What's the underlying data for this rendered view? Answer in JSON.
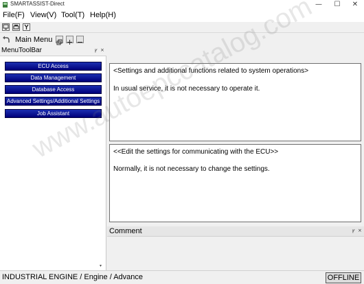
{
  "window": {
    "title": "SMARTASSIST-Direct",
    "controls": {
      "minimize": "—",
      "maximize": "☐",
      "close": "✕"
    }
  },
  "menubar": {
    "items": [
      {
        "label": "File(F)"
      },
      {
        "label": "View(V)"
      },
      {
        "label": "Tool(T)"
      },
      {
        "label": "Help(H)"
      }
    ]
  },
  "toolbar": {
    "icons": [
      "monitor-icon",
      "printer-icon",
      "wrench-icon"
    ]
  },
  "navbar": {
    "title": "Main Menu",
    "back_icon": "back-arrow-icon"
  },
  "left_pane": {
    "title": "MenuToolBar",
    "controls": {
      "restore": "ꝩ",
      "close": "×"
    },
    "buttons": [
      {
        "label": "ECU Access"
      },
      {
        "label": "Data Management"
      },
      {
        "label": "Database Access"
      },
      {
        "label": "Advanced Settings/Additional Settings"
      },
      {
        "label": "Job Assistant"
      }
    ]
  },
  "info_boxes": [
    {
      "heading": "<Settings and additional functions related to system operations>",
      "body": "In usual service, it is not necessary to operate it."
    },
    {
      "heading": "<<Edit the settings for communicating with the ECU>>",
      "body": "Normally, it is not necessary to change the settings."
    }
  ],
  "comment_pane": {
    "title": "Comment"
  },
  "statusbar": {
    "path": "INDUSTRIAL ENGINE / Engine / Advance",
    "connection": "OFFLINE"
  },
  "watermark": "www.autoepccatalog.com",
  "colors": {
    "button_gradient_top": "#1c2fb0",
    "button_gradient_bottom": "#00007a",
    "button_text": "#ffffff"
  }
}
